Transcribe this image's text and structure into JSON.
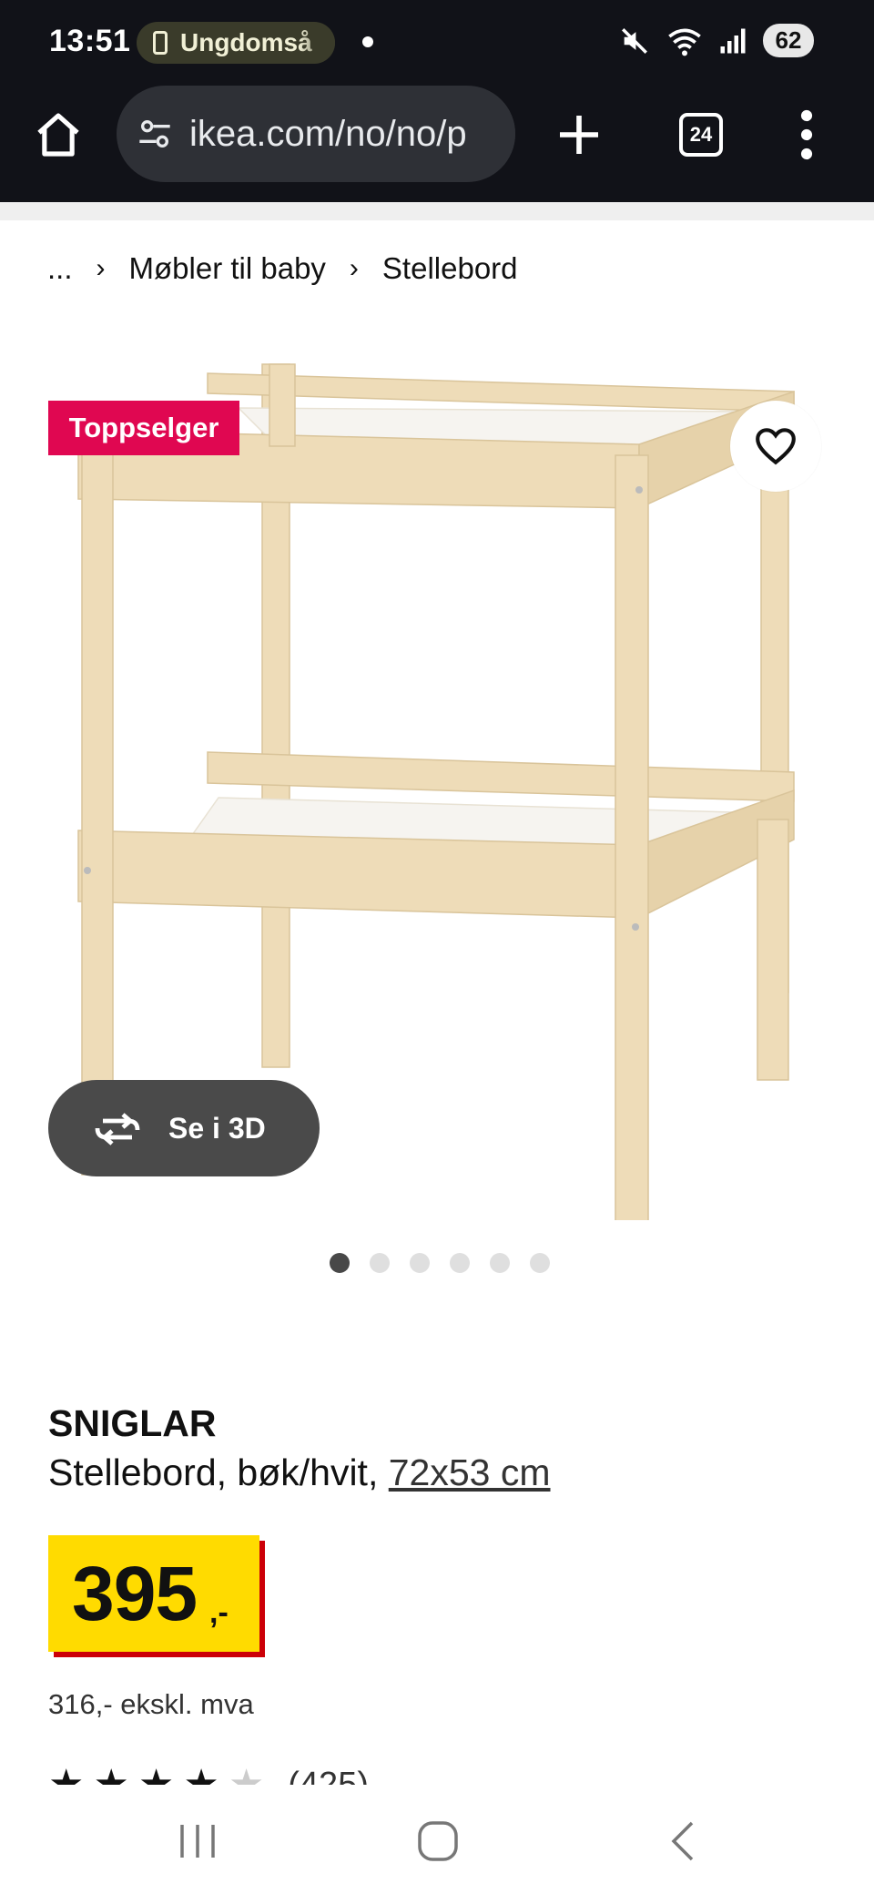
{
  "status_bar": {
    "time": "13:51",
    "notification_label": "Ungdomså",
    "battery": "62"
  },
  "browser": {
    "url": "ikea.com/no/no/p",
    "tab_count": "24"
  },
  "breadcrumb": {
    "ellipsis": "...",
    "items": [
      "Møbler til baby",
      "Stellebord"
    ]
  },
  "product": {
    "badge": "Toppselger",
    "view_3d_label": "Se i 3D",
    "image_count": 6,
    "active_image": 1,
    "name": "SNIGLAR",
    "description": "Stellebord, bøk/hvit,",
    "size": "72x53 cm",
    "price": "395",
    "price_suffix": ",-",
    "price_excl_vat": "316,- ekskl. mva",
    "rating": 4,
    "rating_count": "(425)"
  },
  "colors": {
    "badge_bg": "#e00751",
    "price_bg": "#ffdb00",
    "price_shadow": "#cc0008",
    "chrome_bg": "#111218"
  },
  "icons": {
    "home": "home-icon",
    "site_settings": "tune-icon",
    "new_tab": "plus-icon",
    "menu": "more-vert-icon",
    "favorite": "heart-icon",
    "rotate_3d": "rotate-icon"
  }
}
